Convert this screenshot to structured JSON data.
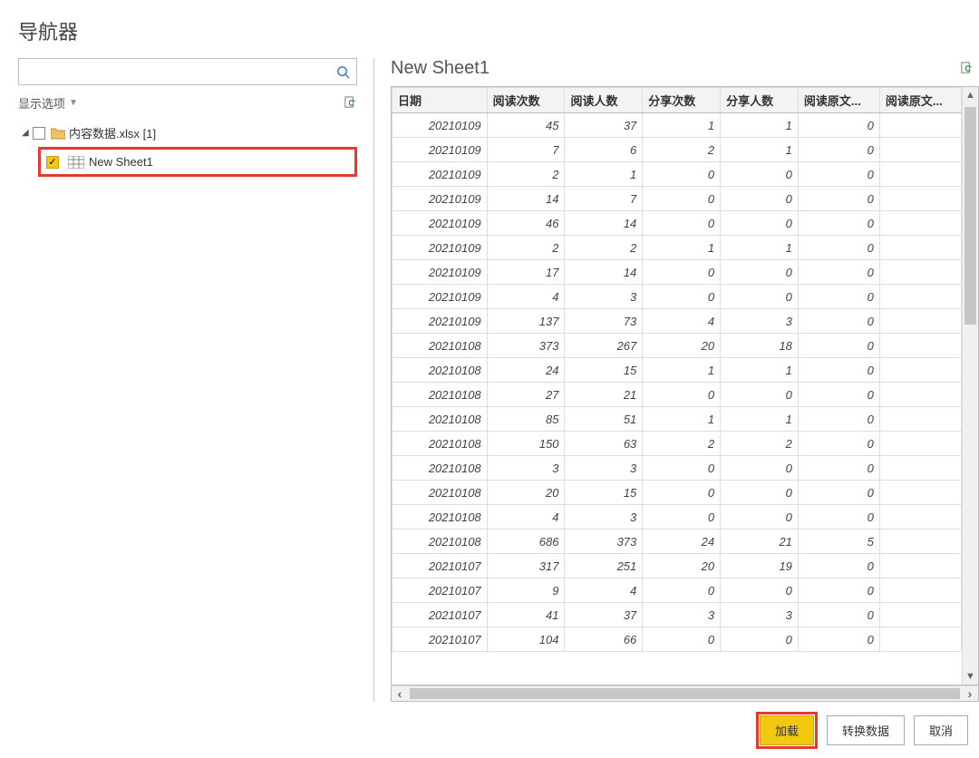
{
  "title": "导航器",
  "search": {
    "placeholder": ""
  },
  "displayOptions": "显示选项",
  "tree": {
    "parent": "内容数据.xlsx [1]",
    "child": "New Sheet1"
  },
  "sheetTitle": "New Sheet1",
  "columns": [
    "日期",
    "阅读次数",
    "阅读人数",
    "分享次数",
    "分享人数",
    "阅读原文...",
    "阅读原文..."
  ],
  "rows": [
    [
      "20210109",
      "45",
      "37",
      "1",
      "1",
      "0",
      ""
    ],
    [
      "20210109",
      "7",
      "6",
      "2",
      "1",
      "0",
      ""
    ],
    [
      "20210109",
      "2",
      "1",
      "0",
      "0",
      "0",
      ""
    ],
    [
      "20210109",
      "14",
      "7",
      "0",
      "0",
      "0",
      ""
    ],
    [
      "20210109",
      "46",
      "14",
      "0",
      "0",
      "0",
      ""
    ],
    [
      "20210109",
      "2",
      "2",
      "1",
      "1",
      "0",
      ""
    ],
    [
      "20210109",
      "17",
      "14",
      "0",
      "0",
      "0",
      ""
    ],
    [
      "20210109",
      "4",
      "3",
      "0",
      "0",
      "0",
      ""
    ],
    [
      "20210109",
      "137",
      "73",
      "4",
      "3",
      "0",
      ""
    ],
    [
      "20210108",
      "373",
      "267",
      "20",
      "18",
      "0",
      ""
    ],
    [
      "20210108",
      "24",
      "15",
      "1",
      "1",
      "0",
      ""
    ],
    [
      "20210108",
      "27",
      "21",
      "0",
      "0",
      "0",
      ""
    ],
    [
      "20210108",
      "85",
      "51",
      "1",
      "1",
      "0",
      ""
    ],
    [
      "20210108",
      "150",
      "63",
      "2",
      "2",
      "0",
      ""
    ],
    [
      "20210108",
      "3",
      "3",
      "0",
      "0",
      "0",
      ""
    ],
    [
      "20210108",
      "20",
      "15",
      "0",
      "0",
      "0",
      ""
    ],
    [
      "20210108",
      "4",
      "3",
      "0",
      "0",
      "0",
      ""
    ],
    [
      "20210108",
      "686",
      "373",
      "24",
      "21",
      "5",
      ""
    ],
    [
      "20210107",
      "317",
      "251",
      "20",
      "19",
      "0",
      ""
    ],
    [
      "20210107",
      "9",
      "4",
      "0",
      "0",
      "0",
      ""
    ],
    [
      "20210107",
      "41",
      "37",
      "3",
      "3",
      "0",
      ""
    ],
    [
      "20210107",
      "104",
      "66",
      "0",
      "0",
      "0",
      ""
    ]
  ],
  "buttons": {
    "load": "加载",
    "transform": "转换数据",
    "cancel": "取消"
  }
}
